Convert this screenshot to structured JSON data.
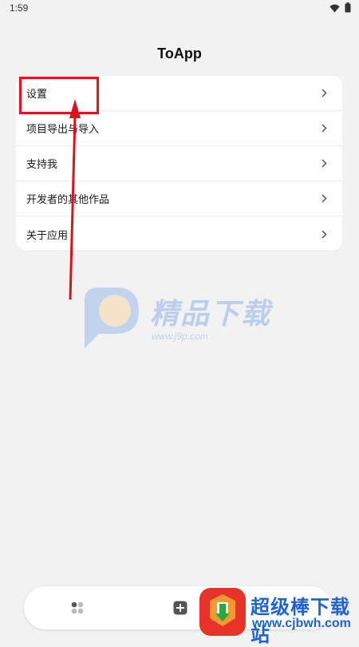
{
  "status_bar": {
    "time": "1:59"
  },
  "header": {
    "title": "ToApp"
  },
  "menu": {
    "items": [
      {
        "label": "设置"
      },
      {
        "label": "项目导出与导入"
      },
      {
        "label": "支持我"
      },
      {
        "label": "开发者的其他作品"
      },
      {
        "label": "关于应用"
      }
    ]
  },
  "watermark": {
    "text": "精品下载",
    "url": "www.j9p.com"
  },
  "brand_watermark": {
    "name": "超级棒下载站",
    "url": "www.cjbwh.com"
  },
  "colors": {
    "accent": "#e3141a",
    "card": "#ffffff",
    "background": "#f2f2f2",
    "brand": "#1e63d6"
  },
  "icons": {
    "status": [
      "wifi-icon",
      "battery-icon"
    ],
    "menu_chevron": "chevron-right-icon",
    "bottom_nav": [
      "grid-icon",
      "add-square-icon"
    ]
  }
}
